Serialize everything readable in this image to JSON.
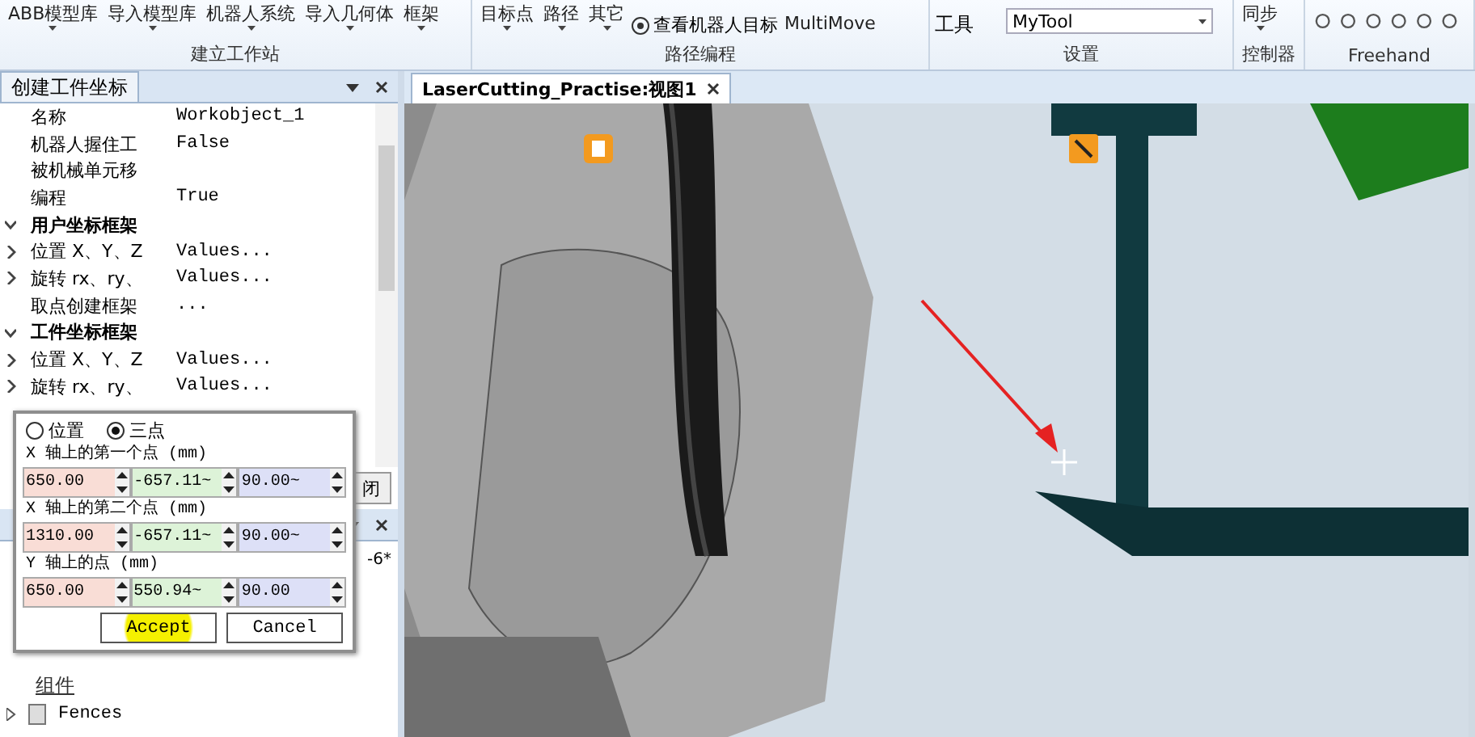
{
  "ribbon": {
    "groups": [
      {
        "kind": "buttons",
        "label": "建立工作站",
        "buttons": [
          {
            "label": "ABB模型库",
            "dropdown": true
          },
          {
            "label": "导入模型库",
            "dropdown": true
          },
          {
            "label": "机器人系统",
            "dropdown": true
          },
          {
            "label": "导入几何体",
            "dropdown": true
          },
          {
            "label": "框架",
            "dropdown": true
          }
        ]
      },
      {
        "kind": "path",
        "label": "路径编程",
        "buttons": [
          {
            "label": "目标点",
            "dropdown": true
          },
          {
            "label": "路径",
            "dropdown": true
          },
          {
            "label": "其它",
            "dropdown": true
          }
        ],
        "small_button": "查看机器人目标",
        "large_button": "MultiMove"
      },
      {
        "kind": "settings",
        "label": "设置",
        "field_label": "工具",
        "field_value": "MyTool"
      },
      {
        "kind": "buttons",
        "label": "控制器",
        "buttons": [
          {
            "label": "同步",
            "dropdown": true
          }
        ]
      },
      {
        "kind": "freehand",
        "label": "Freehand"
      }
    ]
  },
  "left_panel": {
    "title": "创建工件坐标",
    "rows": [
      {
        "kind": "property",
        "name": "名称",
        "value": "Workobject_1"
      },
      {
        "kind": "property",
        "name": "机器人握住工",
        "value": "False"
      },
      {
        "kind": "property",
        "name": "被机械单元移"
      },
      {
        "kind": "property",
        "name": "编程",
        "value": "True"
      },
      {
        "kind": "category",
        "name": "用户坐标框架",
        "expanded": true
      },
      {
        "kind": "group",
        "name": "位置 X、Y、Z",
        "value": "Values...",
        "expanded": false
      },
      {
        "kind": "group",
        "name": "旋转 rx、ry、",
        "value": "Values...",
        "expanded": false
      },
      {
        "kind": "property",
        "name": "取点创建框架",
        "value": "..."
      },
      {
        "kind": "category",
        "name": "工件坐标框架",
        "expanded": true
      },
      {
        "kind": "group",
        "name": "位置 X、Y、Z",
        "value": "Values...",
        "expanded": false
      },
      {
        "kind": "group",
        "name": "旋转 rx、ry、",
        "value": "Values...",
        "expanded": false
      }
    ],
    "close_button": "闭"
  },
  "lower_panel": {
    "side_text": "-6*",
    "section": "组件",
    "tree": [
      {
        "label": "Fences",
        "expanded": false
      }
    ]
  },
  "dialog": {
    "radios": [
      {
        "label": "位置",
        "selected": false
      },
      {
        "label": "三点",
        "selected": true
      }
    ],
    "points": [
      {
        "label": "X 轴上的第一个点 (mm)",
        "values": [
          "650.00",
          "-657.11~",
          "90.00~"
        ]
      },
      {
        "label": "X 轴上的第二个点 (mm)",
        "values": [
          "1310.00",
          "-657.11~",
          "90.00~"
        ]
      },
      {
        "label": "Y 轴上的点 (mm)",
        "values": [
          "650.00",
          "550.94~",
          "90.00"
        ]
      }
    ],
    "buttons": [
      {
        "label": "Accept",
        "highlighted": true
      },
      {
        "label": "Cancel",
        "highlighted": false
      }
    ]
  },
  "viewport": {
    "tab": "LaserCutting_Practise:视图1"
  }
}
